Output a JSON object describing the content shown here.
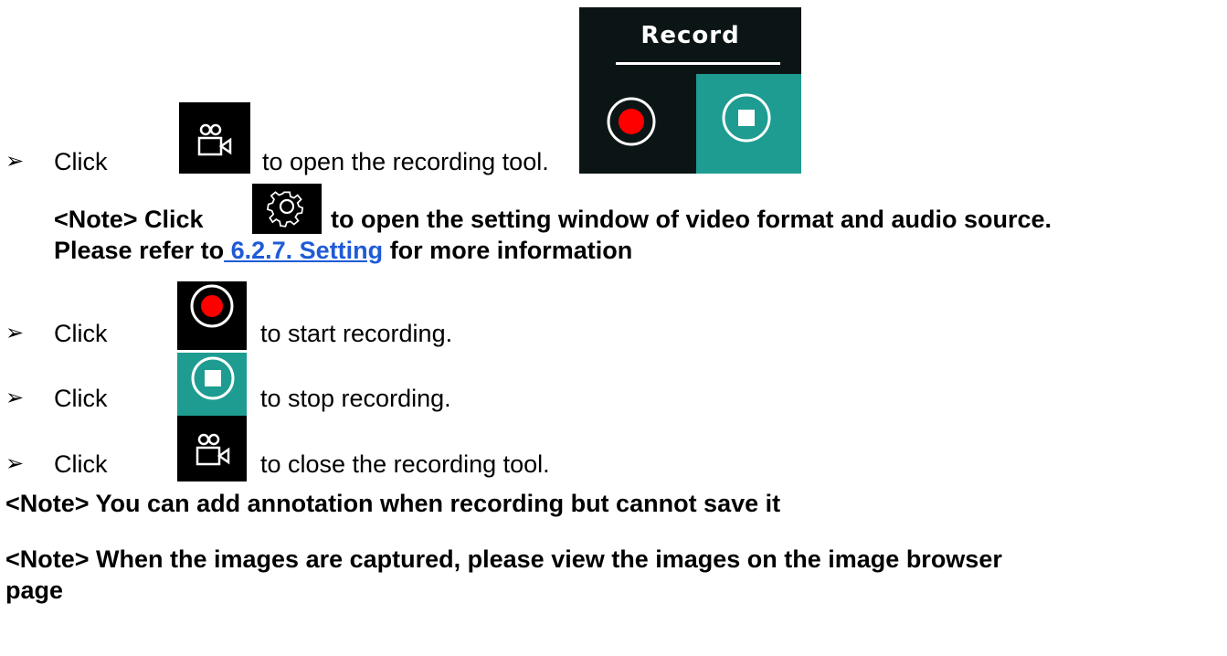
{
  "record_panel": {
    "title": "Record"
  },
  "steps": [
    {
      "bullet": "➢",
      "before": "Click",
      "after": "to open the recording tool.",
      "icon": "camera-icon"
    },
    {
      "bullet": "➢",
      "before": "Click",
      "after": "to start recording.",
      "icon": "record-icon"
    },
    {
      "bullet": "➢",
      "before": "Click",
      "after": "to stop recording.",
      "icon": "stop-icon"
    },
    {
      "bullet": "➢",
      "before": "Click",
      "after": "to close the recording tool.",
      "icon": "camera-icon"
    }
  ],
  "note_setting": {
    "prefix": "<Note> Click",
    "after": "to open the setting window of video format and audio source.",
    "line2_before": "Please refer to",
    "link": " 6.2.7. Setting",
    "line2_after": "for more information",
    "icon": "gear-icon"
  },
  "notes": [
    "<Note> You can add annotation when recording but cannot save it",
    "<Note> When the images are captured, please view the images on the image browser",
    "page"
  ],
  "colors": {
    "record_red": "#ff0000",
    "teal": "#1e9c91",
    "link_blue": "#1f5bd6"
  }
}
